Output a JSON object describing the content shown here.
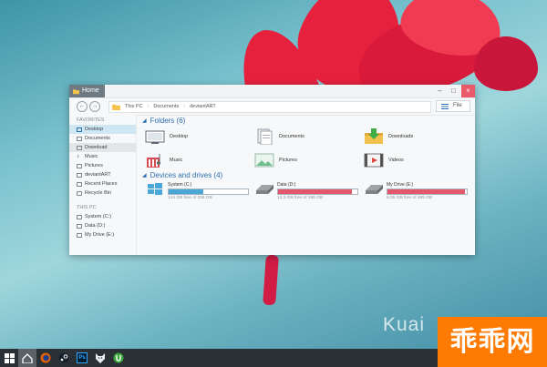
{
  "window": {
    "home_tab": "Home",
    "controls": {
      "minimize": "–",
      "maximize": "□",
      "close": "×"
    },
    "address": [
      "This PC",
      "Documents",
      "deviantART"
    ],
    "file_button": "File"
  },
  "nav": {
    "favorites_label": "FAVORITES",
    "favorites": [
      {
        "label": "Desktop",
        "state": "selected"
      },
      {
        "label": "Documents",
        "state": ""
      },
      {
        "label": "Download",
        "state": "hover"
      },
      {
        "label": "Music",
        "state": ""
      },
      {
        "label": "Pictures",
        "state": ""
      },
      {
        "label": "deviantART",
        "state": ""
      },
      {
        "label": "Recent Places",
        "state": ""
      },
      {
        "label": "Recycle Bin",
        "state": ""
      }
    ],
    "thispc_label": "THIS PC",
    "thispc": [
      {
        "label": "System (C:)"
      },
      {
        "label": "Data (D:)"
      },
      {
        "label": "My Drive (E:)"
      }
    ]
  },
  "folders": {
    "heading": "Folders (6)",
    "items": [
      {
        "label": "Desktop",
        "icon": "desktop-icon"
      },
      {
        "label": "Documents",
        "icon": "documents-icon"
      },
      {
        "label": "Downloads",
        "icon": "downloads-icon"
      },
      {
        "label": "Music",
        "icon": "music-icon"
      },
      {
        "label": "Pictures",
        "icon": "pictures-icon"
      },
      {
        "label": "Videos",
        "icon": "videos-icon"
      }
    ]
  },
  "drives": {
    "heading": "Devices and drives (4)",
    "items": [
      {
        "label": "System (C:)",
        "free": "144 GB free of 256 GB",
        "used_fraction": 0.44,
        "color": "#4aa8d8"
      },
      {
        "label": "Data (D:)",
        "free": "12,3 GB free of 186 GB",
        "used_fraction": 0.93,
        "color": "#e5576b"
      },
      {
        "label": "My Drive (E:)",
        "free": "8,05 GB free of 465 GB",
        "used_fraction": 0.98,
        "color": "#e5576b"
      }
    ]
  },
  "taskbar": {
    "items": [
      "windows-start-icon",
      "explorer-home-icon",
      "firefox-icon",
      "steam-icon",
      "photoshop-icon",
      "wolf-app-icon",
      "utorrent-icon"
    ],
    "photoshop_label": "Ps"
  },
  "overlay": {
    "kualai_text": "Kuai",
    "watermark_text": "乖乖网"
  },
  "colors": {
    "accent": "#2c6fb0",
    "selection": "#cfe6f3",
    "close": "#e8596a"
  }
}
